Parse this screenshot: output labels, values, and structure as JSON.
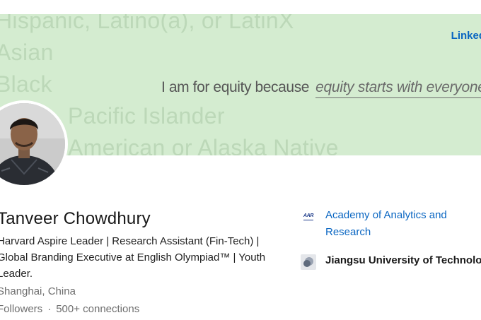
{
  "banner": {
    "background_words": [
      "Hispanic, Latino(a), or LatinX",
      "Asian",
      "Black",
      "Pacific Islander",
      "American or Alaska Native"
    ],
    "brand": "Linked",
    "equity_lead": "I am for equity because",
    "equity_rest": "equity starts with everyone",
    "background_color": "#d4ecd0"
  },
  "profile": {
    "name": "Tanveer Chowdhury",
    "headline": "Harvard Aspire Leader | Research Assistant (Fin-Tech) | Global Branding Executive at English Olympiad™ | Youth Leader.",
    "location": "Shanghai, China",
    "followers": "Followers",
    "separator": "·",
    "connections": "500+ connections"
  },
  "organizations": [
    {
      "name": "Academy of Analytics and Research",
      "logo_text": "AAR",
      "icon": "organization-logo"
    },
    {
      "name": "Jiangsu University of Technology",
      "icon": "university-logo"
    }
  ],
  "colors": {
    "link_blue": "#0a66c2",
    "text_dark": "#191919",
    "text_muted": "#6e6e6e"
  }
}
